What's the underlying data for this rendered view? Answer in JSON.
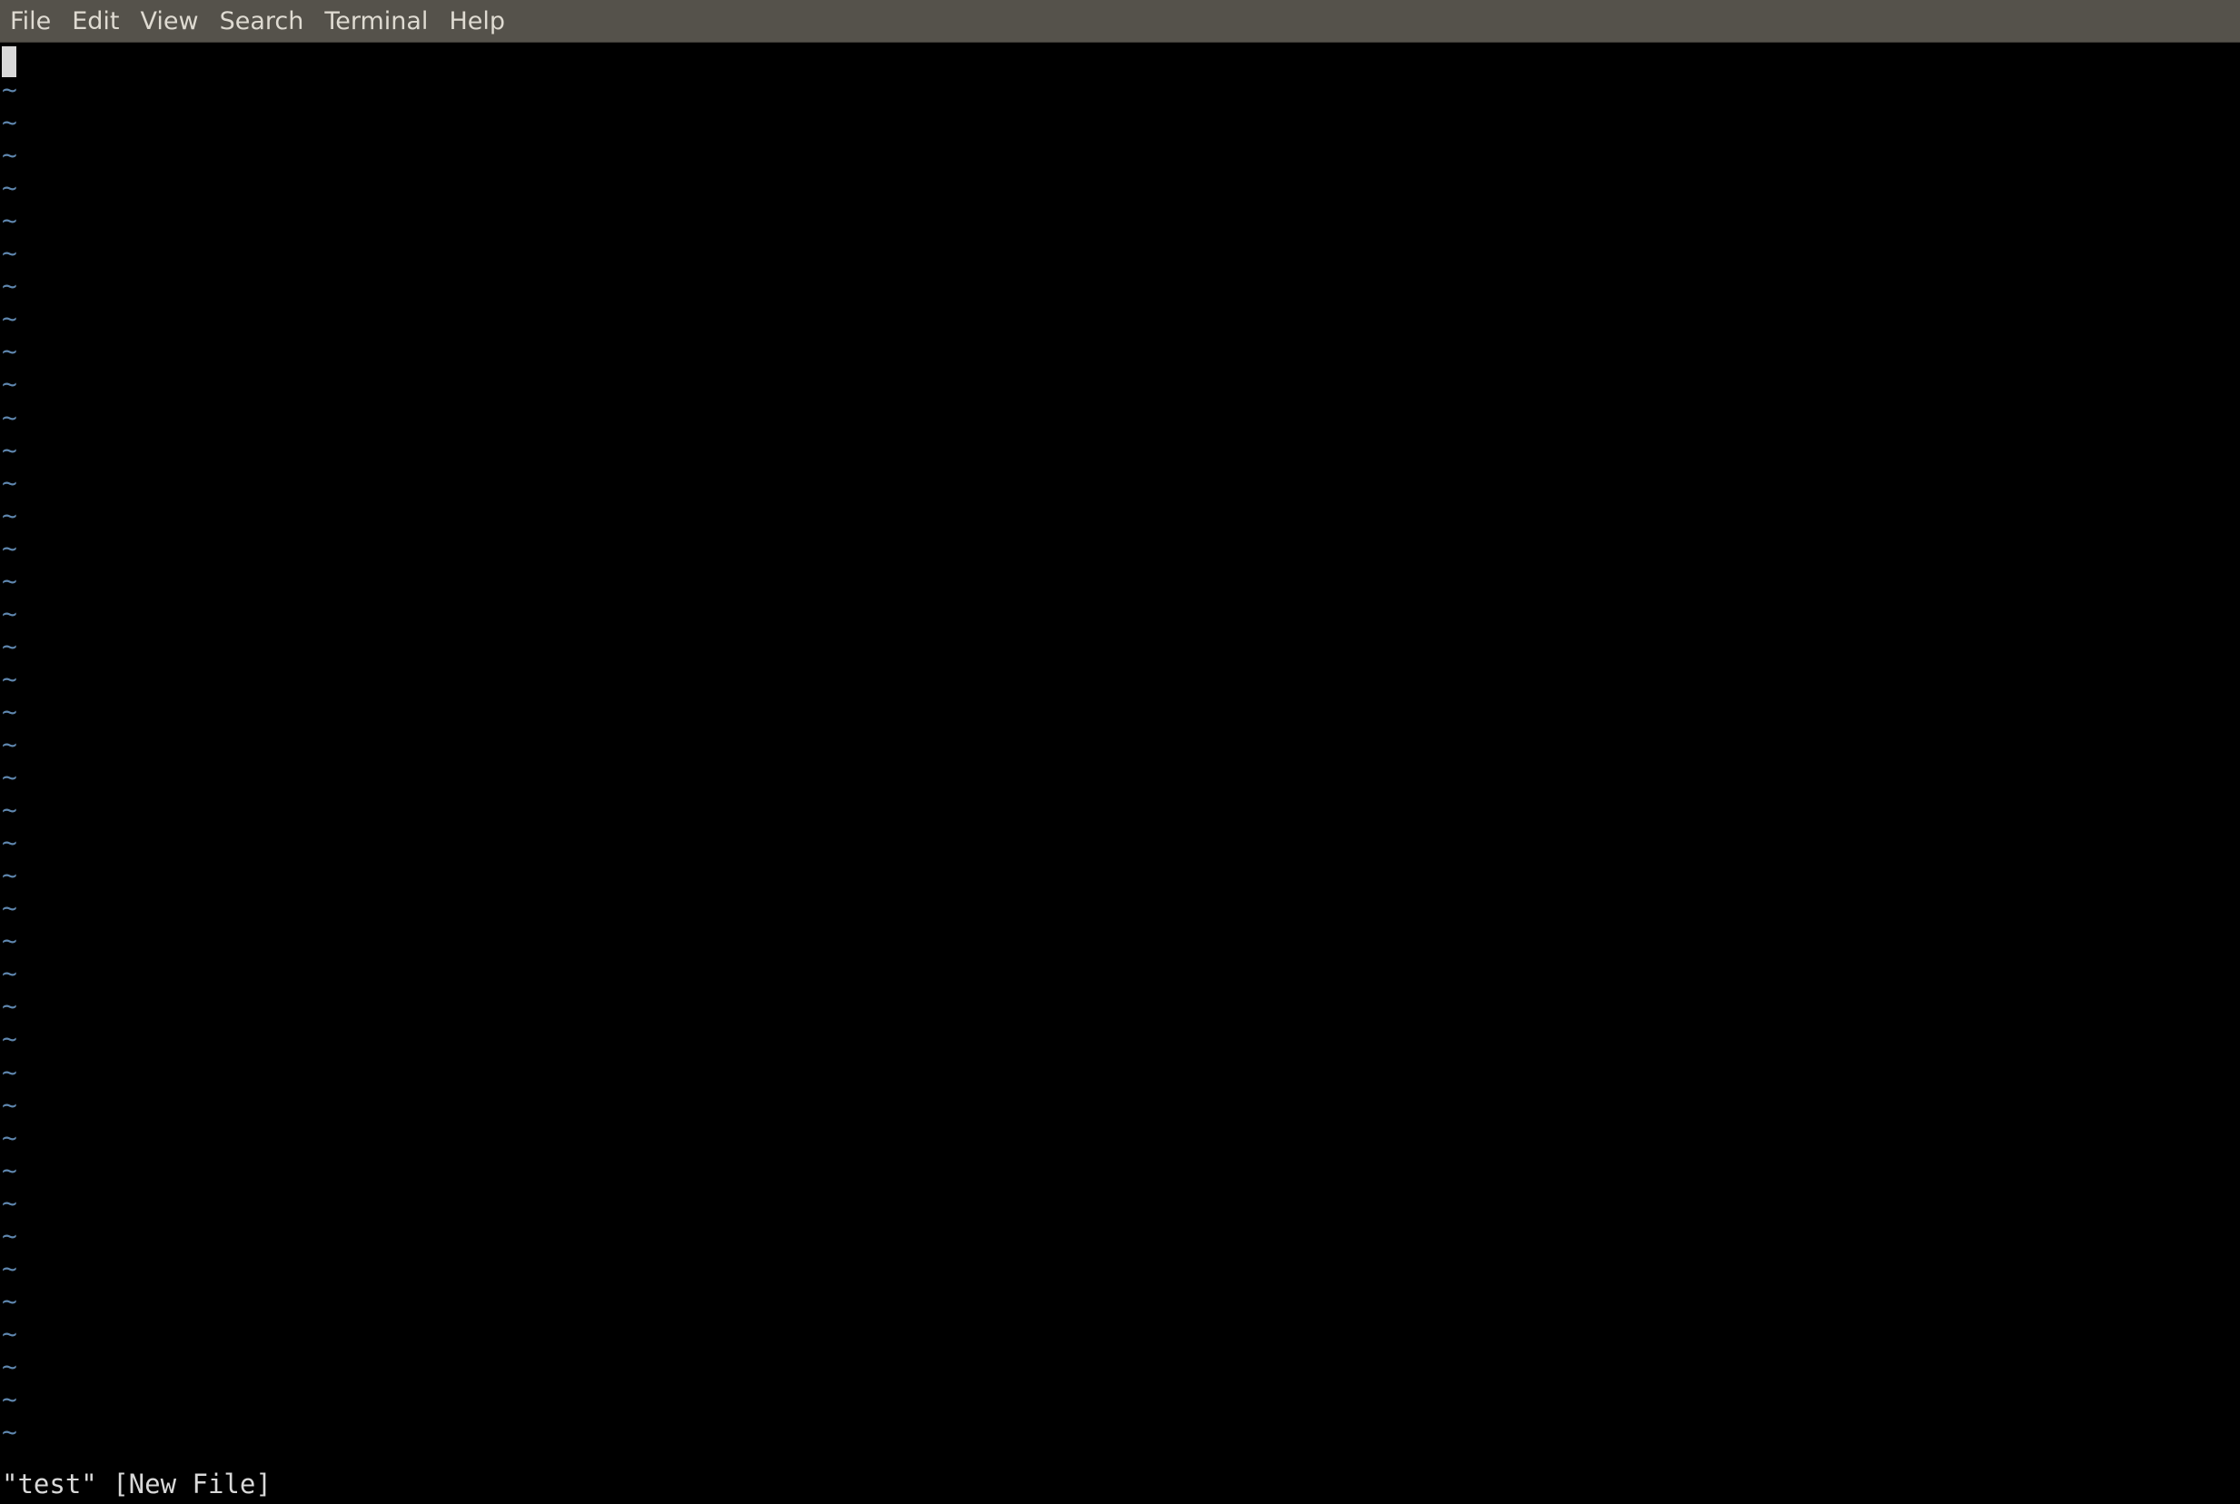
{
  "menubar": {
    "items": [
      {
        "id": "file",
        "label": "File"
      },
      {
        "id": "edit",
        "label": "Edit"
      },
      {
        "id": "view",
        "label": "View"
      },
      {
        "id": "search",
        "label": "Search"
      },
      {
        "id": "terminal",
        "label": "Terminal"
      },
      {
        "id": "help",
        "label": "Help"
      }
    ]
  },
  "editor": {
    "empty_line_marker": "~",
    "empty_line_count": 42,
    "status_message": "\"test\" [New File]"
  },
  "colors": {
    "menubar_bg": "#55524b",
    "menubar_text": "#dfdbd2",
    "terminal_bg": "#000000",
    "tilde": "#5f87af",
    "text": "#d9d9d9",
    "cursor": "#d9d9d9"
  }
}
